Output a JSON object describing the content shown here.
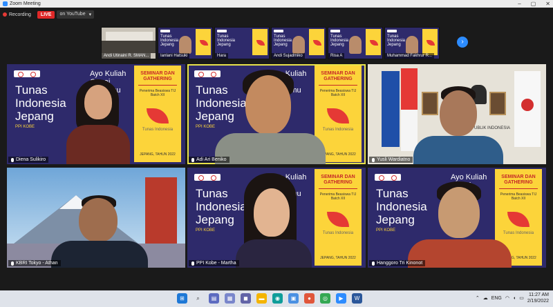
{
  "window": {
    "title": "Zoom Meeting",
    "controls": [
      "–",
      "▢",
      "✕"
    ]
  },
  "recording": {
    "label": "Recording",
    "live_label": "LIVE",
    "stream_label": "on YouTube",
    "caret": "▾"
  },
  "filmstrip": {
    "items": [
      {
        "name": "Andi Utinaini R. SMAN..."
      },
      {
        "name": "Ianlani Hatsuki"
      },
      {
        "name": "Hara"
      },
      {
        "name": "Andi Sujadmiko"
      },
      {
        "name": "Risa A"
      },
      {
        "name": "Muhammad Fakhrur R..."
      }
    ],
    "next_icon": "›"
  },
  "background": {
    "title": "Tunas Indonesia Jepang",
    "ayo": "Ayo Kuliah Gapai Mimpimu",
    "sub": "PPI KOBE",
    "panel_title": "SEMINAR DAN GATHERING",
    "panel_sub": "Penerima Beasiswa TIJ Batch XII",
    "brand": "Tunas Indonesia",
    "date": "JEPANG, TAHUN 2022"
  },
  "tiles": [
    {
      "name": "Diena Sulikiro"
    },
    {
      "name": "Adi Ari Beniko"
    },
    {
      "name": "Yusli Wardiatno"
    },
    {
      "name": "KBRI Tokyo - Athan"
    },
    {
      "name": "PPI Kobe - Martha"
    },
    {
      "name": "Hanggoro Tri Kinonot"
    }
  ],
  "kbri_wall": "PUBLIK INDONESIA",
  "taskbar": {
    "language": "ENG",
    "time": "11:27 AM",
    "date": "2/19/2022",
    "tray_chevron": "⌃"
  },
  "colors": {
    "slide_bg": "#2e2a6b",
    "panel": "#fcd43a",
    "accent_red": "#e53935",
    "active_border": "#e9e34a",
    "zoom_blue": "#2d8cff"
  }
}
